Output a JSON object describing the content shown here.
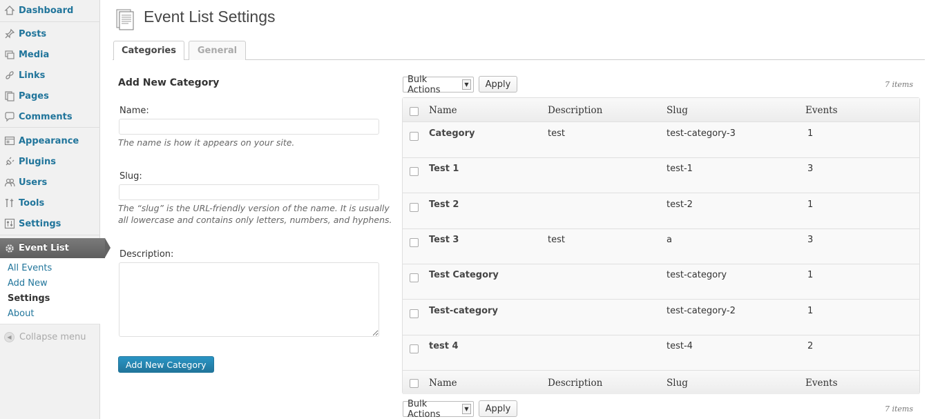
{
  "sidebar": {
    "items": [
      {
        "label": "Dashboard",
        "icon": "dashboard-icon"
      },
      {
        "label": "Posts",
        "icon": "posts-icon"
      },
      {
        "label": "Media",
        "icon": "media-icon"
      },
      {
        "label": "Links",
        "icon": "links-icon"
      },
      {
        "label": "Pages",
        "icon": "pages-icon"
      },
      {
        "label": "Comments",
        "icon": "comments-icon"
      },
      {
        "label": "Appearance",
        "icon": "appearance-icon"
      },
      {
        "label": "Plugins",
        "icon": "plugins-icon"
      },
      {
        "label": "Users",
        "icon": "users-icon"
      },
      {
        "label": "Tools",
        "icon": "tools-icon"
      },
      {
        "label": "Settings",
        "icon": "settings-icon"
      },
      {
        "label": "Event List",
        "icon": "gear-icon",
        "active": true
      }
    ],
    "submenu": [
      "All Events",
      "Add New",
      "Settings",
      "About"
    ],
    "submenu_current": "Settings",
    "collapse_label": "Collapse menu"
  },
  "page": {
    "title": "Event List Settings",
    "tabs": [
      {
        "label": "Categories",
        "active": true
      },
      {
        "label": "General",
        "active": false
      }
    ]
  },
  "form": {
    "heading": "Add New Category",
    "name_label": "Name:",
    "name_value": "",
    "name_hint": "The name is how it appears on your site.",
    "slug_label": "Slug:",
    "slug_value": "",
    "slug_hint": "The “slug” is the URL-friendly version of the name. It is usually all lowercase and contains only letters, numbers, and hyphens.",
    "description_label": "Description:",
    "description_value": "",
    "submit_label": "Add New Category"
  },
  "table": {
    "bulk_actions_label": "Bulk Actions",
    "apply_label": "Apply",
    "items_count": "7 items",
    "columns": [
      "Name",
      "Description",
      "Slug",
      "Events"
    ],
    "rows": [
      {
        "name": "Category",
        "description": "test",
        "slug": "test-category-3",
        "events": "1"
      },
      {
        "name": "Test 1",
        "description": "",
        "slug": "test-1",
        "events": "3"
      },
      {
        "name": "Test 2",
        "description": "",
        "slug": "test-2",
        "events": "1"
      },
      {
        "name": "Test 3",
        "description": "test",
        "slug": "a",
        "events": "3"
      },
      {
        "name": "Test Category",
        "description": "",
        "slug": "test-category",
        "events": "1"
      },
      {
        "name": "Test-category",
        "description": "",
        "slug": "test-category-2",
        "events": "1"
      },
      {
        "name": "test 4",
        "description": "",
        "slug": "test-4",
        "events": "2"
      }
    ]
  },
  "colors": {
    "link": "#21759b",
    "active_menu": "#5e5e5e",
    "primary_button": "#21759b"
  }
}
